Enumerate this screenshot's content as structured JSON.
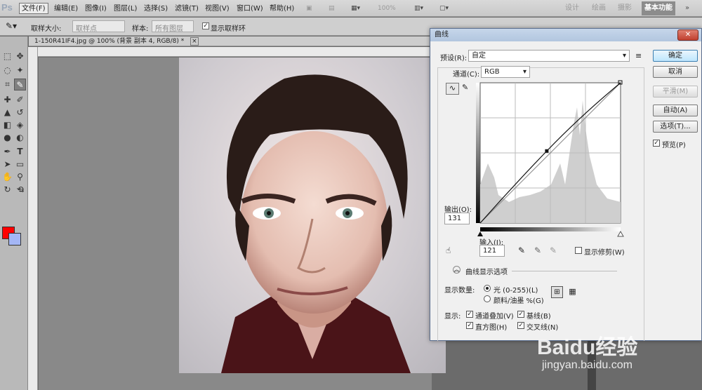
{
  "app": {
    "logo": "Ps"
  },
  "menu": [
    "文件(F)",
    "编辑(E)",
    "图像(I)",
    "图层(L)",
    "选择(S)",
    "滤镜(T)",
    "视图(V)",
    "窗口(W)",
    "帮助(H)"
  ],
  "toolbar_zoom": "100%",
  "workspaces": [
    "设计",
    "绘画",
    "摄影",
    "基本功能"
  ],
  "options": {
    "sample_size_label": "取样大小:",
    "sample_size_value": "取样点",
    "sample_label": "样本:",
    "sample_value": "所有图层",
    "show_ring_label": "显示取样环"
  },
  "document": {
    "tab_title": "1-150R41IF4.jpg @ 100% (背景 副本 4, RGB/8) *"
  },
  "curves": {
    "title": "曲线",
    "preset_label": "预设(R):",
    "preset_value": "自定",
    "channel_label": "通道(C):",
    "channel_value": "RGB",
    "output_label": "输出(O):",
    "output_value": "131",
    "input_label": "输入(I):",
    "input_value": "121",
    "show_clipping_label": "显示修剪(W)",
    "display_options_label": "曲线显示选项",
    "show_amount_label": "显示数量:",
    "light_label": "光 (0-255)(L)",
    "pigment_label": "颜料/油墨 %(G)",
    "show_label": "显示:",
    "channel_overlay_label": "通道叠加(V)",
    "baseline_label": "基线(B)",
    "histogram_label": "直方图(H)",
    "intersection_label": "交叉线(N)",
    "buttons": {
      "ok": "确定",
      "cancel": "取消",
      "smooth": "平滑(M)",
      "auto": "自动(A)",
      "options": "选项(T)...",
      "preview": "预览(P)"
    },
    "curve_point": {
      "input": 121,
      "output": 131
    }
  },
  "watermark": {
    "brand": "Baidu经验",
    "url": "jingyan.baidu.com"
  }
}
